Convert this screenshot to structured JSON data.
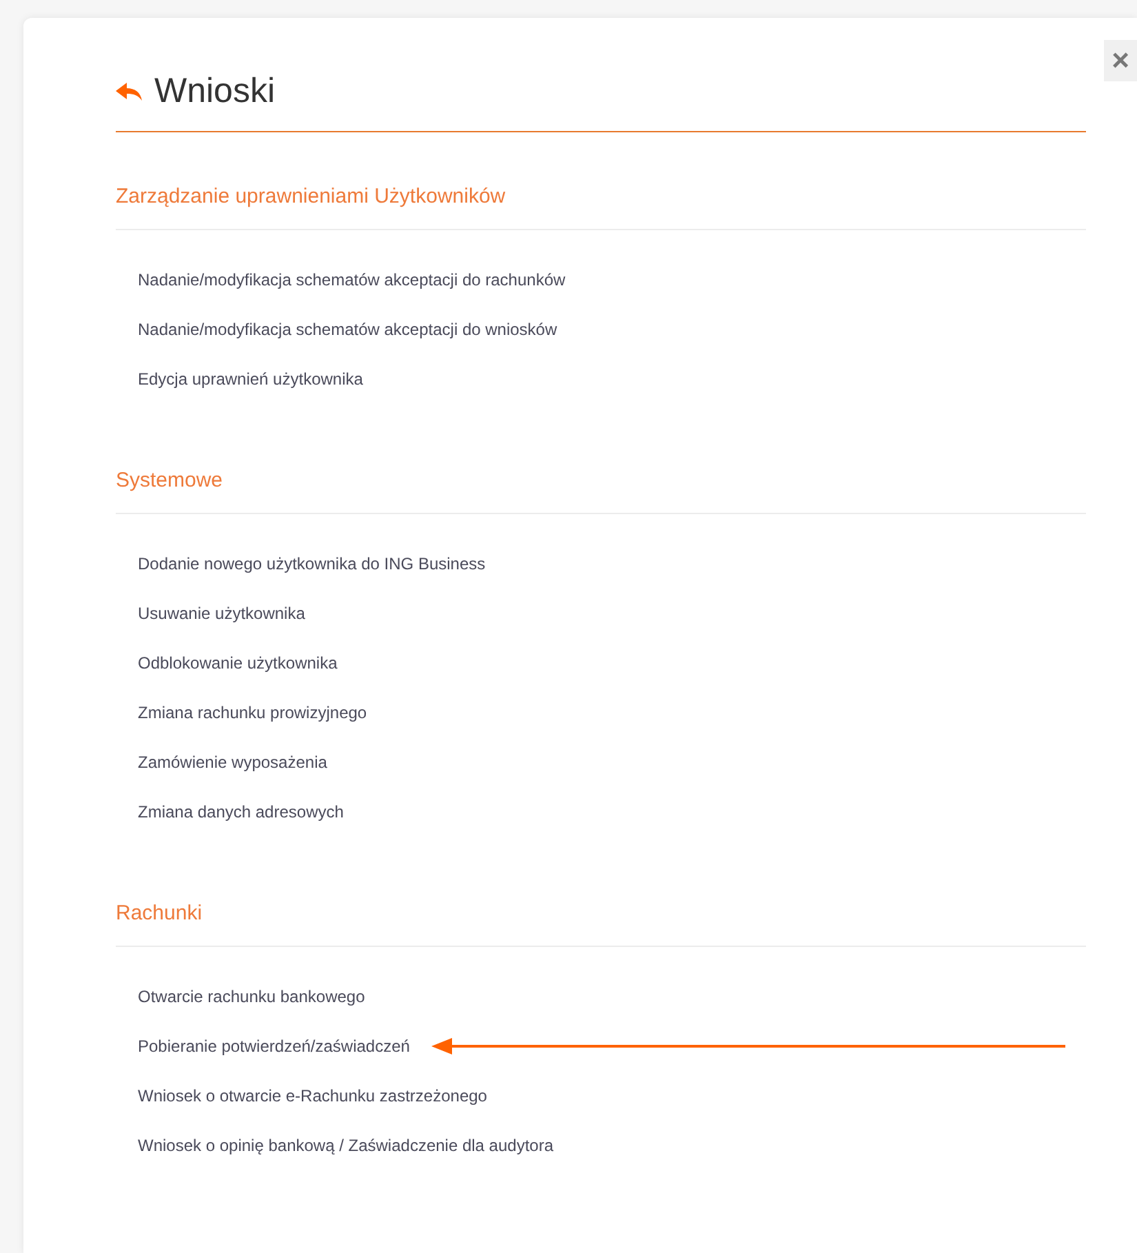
{
  "dialog": {
    "title": "Wnioski",
    "close_label": "×"
  },
  "sections": [
    {
      "heading": "Zarządzanie uprawnieniami Użytkowników",
      "items": [
        {
          "label": "Nadanie/modyfikacja schematów akceptacji do rachunków",
          "pointed": false
        },
        {
          "label": "Nadanie/modyfikacja schematów akceptacji do wniosków",
          "pointed": false
        },
        {
          "label": "Edycja uprawnień użytkownika",
          "pointed": false
        }
      ]
    },
    {
      "heading": "Systemowe",
      "items": [
        {
          "label": "Dodanie nowego użytkownika do ING Business",
          "pointed": false
        },
        {
          "label": "Usuwanie użytkownika",
          "pointed": false
        },
        {
          "label": "Odblokowanie użytkownika",
          "pointed": false
        },
        {
          "label": "Zmiana rachunku prowizyjnego",
          "pointed": false
        },
        {
          "label": "Zamówienie wyposażenia",
          "pointed": false
        },
        {
          "label": "Zmiana danych adresowych",
          "pointed": false
        }
      ]
    },
    {
      "heading": "Rachunki",
      "items": [
        {
          "label": "Otwarcie rachunku bankowego",
          "pointed": false
        },
        {
          "label": "Pobieranie potwierdzeń/zaświadczeń",
          "pointed": true
        },
        {
          "label": "Wniosek o otwarcie e-Rachunku zastrzeżonego",
          "pointed": false
        },
        {
          "label": "Wniosek o opinię bankową / Zaświadczenie dla audytora",
          "pointed": false
        }
      ]
    }
  ]
}
